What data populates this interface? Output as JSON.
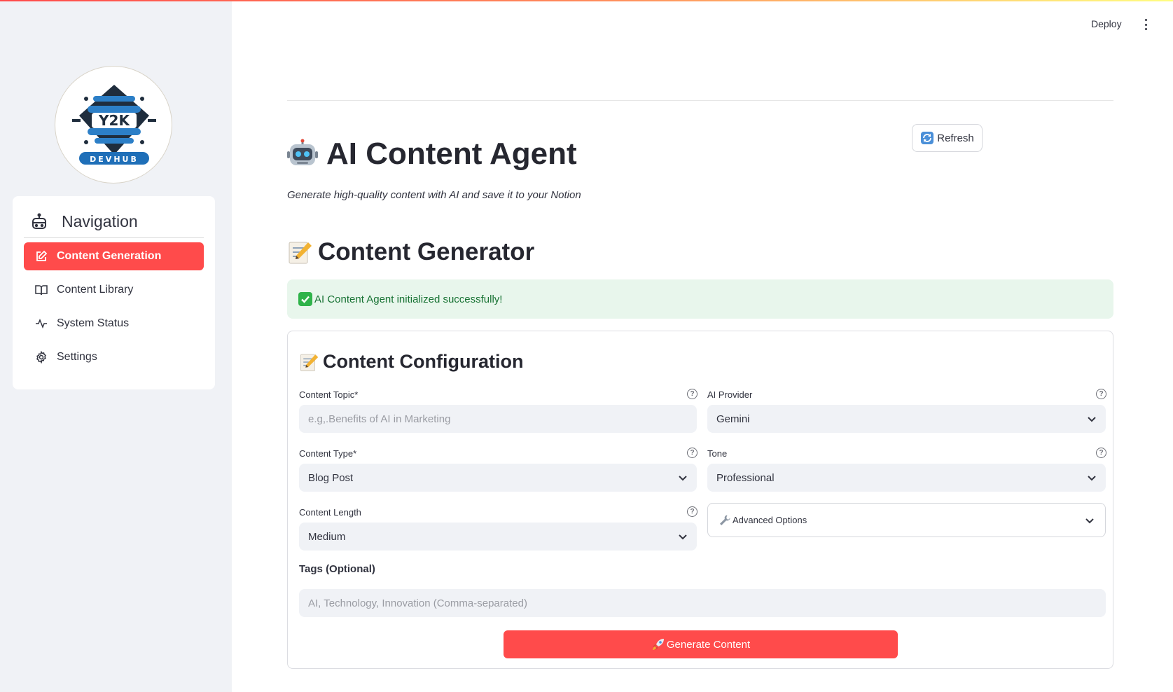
{
  "header": {
    "deploy_label": "Deploy"
  },
  "sidebar": {
    "logo": {
      "text_main": "Y2K",
      "text_sub": "DEVHUB"
    },
    "nav_title": "Navigation",
    "items": [
      {
        "label": "Content Generation",
        "icon": "edit-icon",
        "active": true
      },
      {
        "label": "Content Library",
        "icon": "book-icon",
        "active": false
      },
      {
        "label": "System Status",
        "icon": "activity-icon",
        "active": false
      },
      {
        "label": "Settings",
        "icon": "gear-icon",
        "active": false
      }
    ]
  },
  "main": {
    "refresh_label": "Refresh",
    "title": "AI Content Agent",
    "subtitle": "Generate high-quality content with AI and save it to your Notion",
    "section_title": "Content Generator",
    "success_message": "AI Content Agent initialized successfully!",
    "form": {
      "title": "Content Configuration",
      "topic": {
        "label": "Content Topic*",
        "placeholder": "e.g,.Benefits of AI in Marketing"
      },
      "provider": {
        "label": "AI Provider",
        "value": "Gemini"
      },
      "type": {
        "label": "Content Type*",
        "value": "Blog Post"
      },
      "tone": {
        "label": "Tone",
        "value": "Professional"
      },
      "length": {
        "label": "Content Length",
        "value": "Medium"
      },
      "advanced_label": "Advanced Options",
      "tags": {
        "label": "Tags (Optional)",
        "placeholder": "AI, Technology, Innovation (Comma-separated)"
      },
      "generate_label": "Generate Content"
    }
  },
  "colors": {
    "accent": "#ff4b4b",
    "sidebar_bg": "#f0f2f6",
    "success_bg": "#e8f6ec",
    "success_text": "#177233"
  }
}
